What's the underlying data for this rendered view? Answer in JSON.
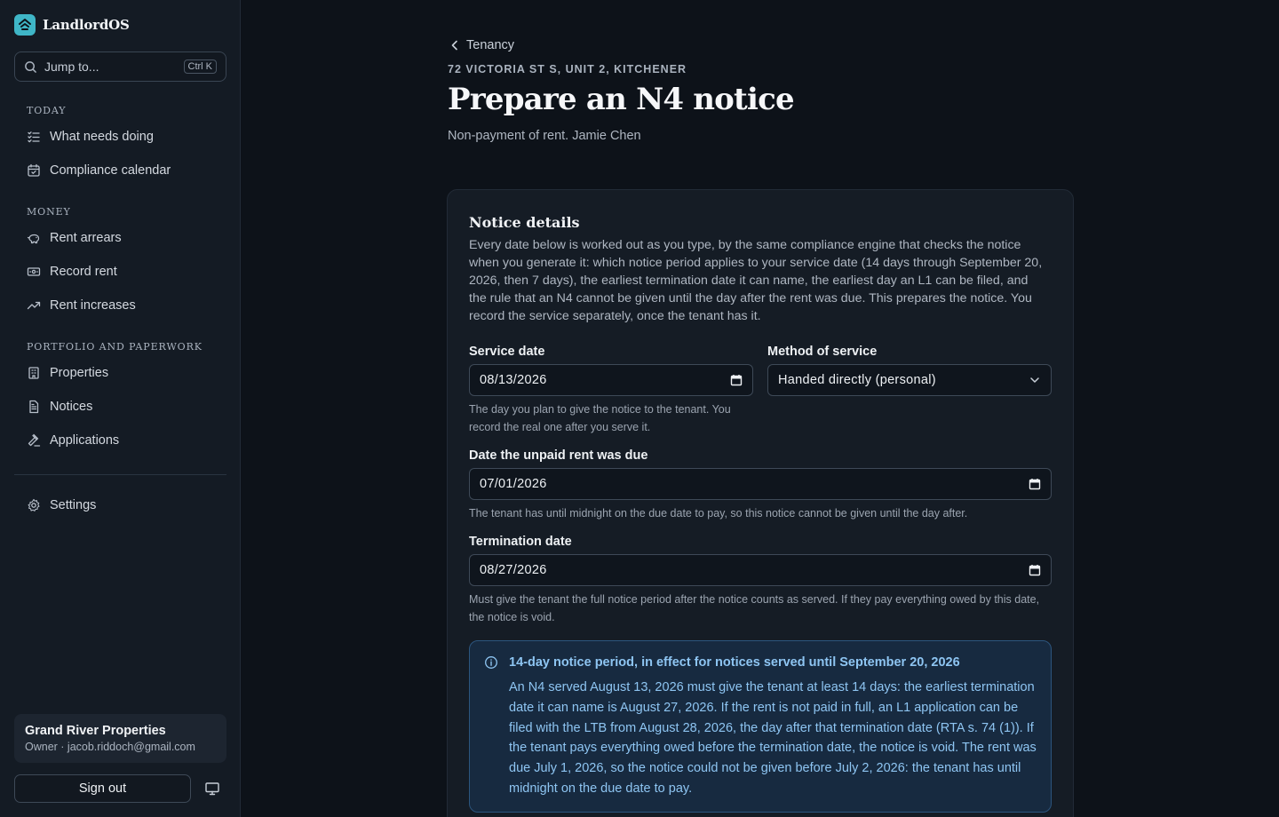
{
  "app": {
    "name": "LandlordOS"
  },
  "search": {
    "placeholder": "Jump to...",
    "shortcut": "Ctrl K"
  },
  "sidebar": {
    "sections": [
      {
        "title": "TODAY",
        "items": [
          {
            "label": "What needs doing",
            "icon": "checklist-icon"
          },
          {
            "label": "Compliance calendar",
            "icon": "calendar-icon"
          }
        ]
      },
      {
        "title": "MONEY",
        "items": [
          {
            "label": "Rent arrears",
            "icon": "piggy-bank-icon"
          },
          {
            "label": "Record rent",
            "icon": "banknote-icon"
          },
          {
            "label": "Rent increases",
            "icon": "trending-up-icon"
          }
        ]
      },
      {
        "title": "PORTFOLIO AND PAPERWORK",
        "items": [
          {
            "label": "Properties",
            "icon": "building-icon"
          },
          {
            "label": "Notices",
            "icon": "document-icon"
          },
          {
            "label": "Applications",
            "icon": "gavel-icon"
          }
        ]
      }
    ],
    "settings": {
      "label": "Settings",
      "icon": "gear-icon"
    },
    "account": {
      "name": "Grand River Properties",
      "role": "Owner · jacob.riddoch@gmail.com"
    },
    "signout": "Sign out"
  },
  "page": {
    "back": "Tenancy",
    "address": "72 VICTORIA ST S, UNIT 2, KITCHENER",
    "title": "Prepare an N4 notice",
    "subtitle": "Non-payment of rent.  Jamie Chen"
  },
  "card": {
    "title": "Notice details",
    "description": "Every date below is worked out as you type, by the same compliance engine that checks the notice when you generate it: which notice period applies to your service date (14 days through September 20, 2026, then 7 days), the earliest termination date it can name, the earliest day an L1 can be filed, and the rule that an N4 cannot be given until the day after the rent was due. This prepares the notice. You record the service separately, once the tenant has it."
  },
  "form": {
    "service_date": {
      "label": "Service date",
      "value": "08/13/2026",
      "help": "The day you plan to give the notice to the tenant. You record the real one after you serve it."
    },
    "method": {
      "label": "Method of service",
      "value": "Handed directly (personal)"
    },
    "due_date": {
      "label": "Date the unpaid rent was due",
      "value": "07/01/2026",
      "help": "The tenant has until midnight on the due date to pay, so this notice cannot be given until the day after."
    },
    "termination_date": {
      "label": "Termination date",
      "value": "08/27/2026",
      "help": "Must give the tenant the full notice period after the notice counts as served. If they pay everything owed by this date, the notice is void."
    }
  },
  "info": {
    "title": "14-day notice period, in effect for notices served until September 20, 2026",
    "body": "An N4 served August 13, 2026 must give the tenant at least 14 days: the earliest termination date it can name is August 27, 2026. If the rent is not paid in full, an L1 application can be filed with the LTB from August 28, 2026, the day after that termination date (RTA s. 74 (1)). If the tenant pays everything owed before the termination date, the notice is void. The rent was due July 1, 2026, so the notice could not be given before July 2, 2026: the tenant has until midnight on the due date to pay."
  },
  "colors": {
    "accent": "#3fb6c7",
    "info_text": "#8ec5f2",
    "info_bg": "#172a40",
    "background": "#0d1219"
  }
}
